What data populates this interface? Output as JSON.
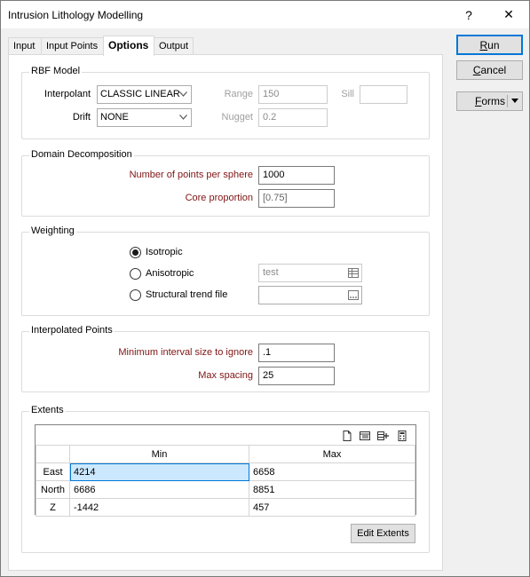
{
  "window": {
    "title": "Intrusion Lithology Modelling",
    "help_label": "?",
    "close_label": "✕"
  },
  "tabs": [
    {
      "label": "Input"
    },
    {
      "label": "Input Points"
    },
    {
      "label": "Options"
    },
    {
      "label": "Output"
    }
  ],
  "active_tab": "Options",
  "buttons": {
    "run_pre": "",
    "run_u": "R",
    "run_post": "un",
    "cancel_u": "C",
    "cancel_post": "ancel",
    "forms_u": "F",
    "forms_post": "orms"
  },
  "rbf_model": {
    "title": "RBF Model",
    "interpolant_label": "Interpolant",
    "interpolant_value": "CLASSIC LINEAR",
    "drift_label": "Drift",
    "drift_value": "NONE",
    "range_label": "Range",
    "range_value": "150",
    "sill_label": "Sill",
    "sill_value": "",
    "nugget_label": "Nugget",
    "nugget_value": "0.2"
  },
  "domain_decomposition": {
    "title": "Domain Decomposition",
    "points_label": "Number of points per sphere",
    "points_value": "1000",
    "core_label": "Core proportion",
    "core_placeholder": "[0.75]"
  },
  "weighting": {
    "title": "Weighting",
    "options": [
      {
        "label": "Isotropic",
        "selected": true
      },
      {
        "label": "Anisotropic",
        "selected": false
      },
      {
        "label": "Structural trend file",
        "selected": false
      }
    ],
    "anisotropic_value": "test",
    "structural_value": ""
  },
  "interpolated_points": {
    "title": "Interpolated Points",
    "min_interval_label": "Minimum interval size to ignore",
    "min_interval_value": ".1",
    "max_spacing_label": "Max spacing",
    "max_spacing_value": "25"
  },
  "extents": {
    "title": "Extents",
    "columns": [
      "Min",
      "Max"
    ],
    "rows": [
      {
        "label": "East",
        "min": "4214",
        "max": "6658"
      },
      {
        "label": "North",
        "min": "6686",
        "max": "8851"
      },
      {
        "label": "Z",
        "min": "-1442",
        "max": "457"
      }
    ],
    "edit_button": "Edit Extents",
    "toolbar_icons": [
      "new-file-icon",
      "list-view-icon",
      "insert-row-icon",
      "calculator-icon"
    ]
  },
  "colors": {
    "required_label": "#7f1414",
    "selection": "#cce8ff",
    "accent": "#0078d7"
  }
}
